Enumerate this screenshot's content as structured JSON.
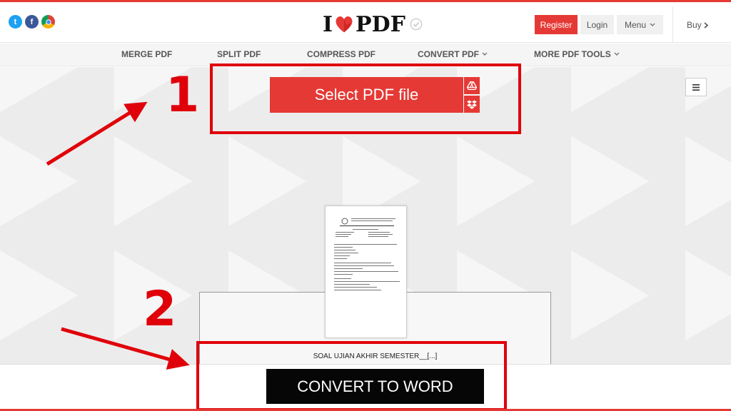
{
  "header": {
    "social": [
      {
        "icon": "twitter-icon",
        "glyph": "t",
        "color": "#1da1f2"
      },
      {
        "icon": "facebook-icon",
        "glyph": "f",
        "color": "#3b5998"
      },
      {
        "icon": "chrome-icon",
        "glyph": "",
        "color": "#4caf50"
      }
    ],
    "logo_left": "I",
    "logo_right": "PDF",
    "register_label": "Register",
    "login_label": "Login",
    "menu_label": "Menu",
    "buy_label": "Buy"
  },
  "nav": {
    "items": [
      {
        "label": "MERGE PDF"
      },
      {
        "label": "SPLIT PDF"
      },
      {
        "label": "COMPRESS PDF"
      },
      {
        "label": "CONVERT PDF"
      },
      {
        "label": "MORE PDF TOOLS"
      }
    ]
  },
  "main": {
    "select_label": "Select PDF file",
    "file_name": "SOAL UJIAN AKHIR SEMESTER__[...]",
    "convert_label": "CONVERT TO WORD"
  },
  "annotations": {
    "step1": "1",
    "step2": "2"
  },
  "colors": {
    "brand": "#e53935",
    "annotation": "#e0000a"
  }
}
